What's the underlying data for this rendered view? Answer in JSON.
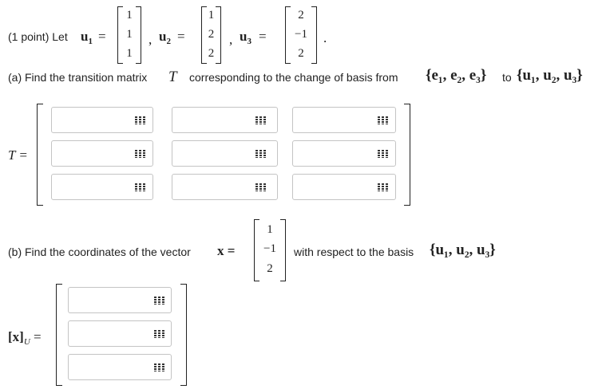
{
  "intro": {
    "prefix": "(1 point) Let",
    "u1_name": "u",
    "u1_sub": "1",
    "u1_values": [
      "1",
      "1",
      "1"
    ],
    "u2_name": "u",
    "u2_sub": "2",
    "u2_values": [
      "1",
      "2",
      "2"
    ],
    "u3_name": "u",
    "u3_sub": "3",
    "u3_values": [
      "2",
      "−1",
      "2"
    ],
    "eq": "=",
    "comma": ",",
    "period": "."
  },
  "part_a": {
    "text1": "(a) Find the transition matrix",
    "T": "T",
    "text2": "corresponding to the change of basis from",
    "from_basis": "{e₁, e₂, e₃}",
    "to_word": "to",
    "to_basis": "{u₁, u₂, u₃}",
    "matrix_label": "T =",
    "cells": [
      "",
      "",
      "",
      "",
      "",
      "",
      "",
      "",
      ""
    ]
  },
  "part_b": {
    "text1": "(b) Find the coordinates of the vector",
    "x_label": "x =",
    "x_values": [
      "1",
      "−1",
      "2"
    ],
    "text2": "with respect to the basis",
    "basis": "{u₁, u₂, u₃}",
    "vector_label_x": "[x]",
    "vector_label_sub": "U",
    "vector_label_eq": "=",
    "cells": [
      "",
      "",
      ""
    ]
  },
  "icons": {
    "equation_editor": "equation-editor-icon"
  }
}
